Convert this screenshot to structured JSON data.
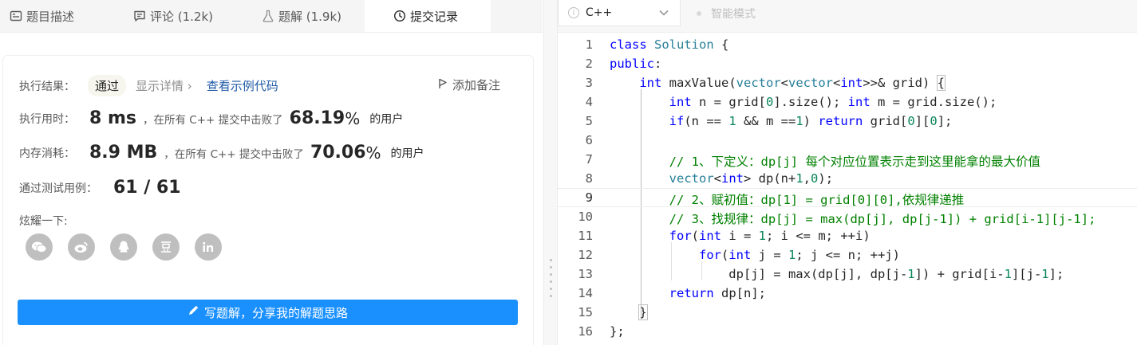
{
  "tabs": [
    {
      "label": "题目描述"
    },
    {
      "label": "评论 (1.2k)"
    },
    {
      "label": "题解 (1.9k)"
    },
    {
      "label": "提交记录"
    }
  ],
  "editor": {
    "language": "C++",
    "smart_mode": "智能模式"
  },
  "result": {
    "status_key": "执行结果：",
    "status": "通过",
    "show_details": "显示详情 ›",
    "view_example": "查看示例代码",
    "add_note": "添加备注",
    "runtime_key": "执行用时：",
    "runtime": "8 ms",
    "runtime_beat_text": "，在所有 C++ 提交中击败了",
    "runtime_pct": "68.19",
    "memory_key": "内存消耗：",
    "memory": "8.9 MB",
    "memory_beat_text": "，在所有 C++ 提交中击败了",
    "memory_pct": "70.06",
    "pct_sign": "%",
    "users_suffix": "的用户",
    "testcases_key": "通过测试用例：",
    "testcases": "61 / 61",
    "share_label": "炫耀一下:",
    "share_icons": [
      "wechat-icon",
      "weibo-icon",
      "qq-icon",
      "douban-icon",
      "linkedin-icon"
    ],
    "write_solution": "写题解，分享我的解题思路"
  },
  "code": {
    "line_numbers": [
      "1",
      "2",
      "3",
      "4",
      "5",
      "6",
      "7",
      "8",
      "9",
      "10",
      "11",
      "12",
      "13",
      "14",
      "15",
      "16"
    ],
    "lines": [
      "class Solution {",
      "public:",
      "    int maxValue(vector<vector<int>>& grid) {",
      "        int n = grid[0].size(); int m = grid.size();",
      "        if(n == 1 && m ==1) return grid[0][0];",
      "",
      "        // 1、下定义：dp[j] 每个对应位置表示走到这里能拿的最大价值",
      "        vector<int> dp(n+1,0);",
      "        // 2、赋初值：dp[1] = grid[0][0],依规律递推",
      "        // 3、找规律：dp[j] = max(dp[j], dp[j-1]) + grid[i-1][j-1];",
      "        for(int i = 1; i <= m; ++i)",
      "            for(int j = 1; j <= n; ++j)",
      "                dp[j] = max(dp[j], dp[j-1]) + grid[i-1][j-1];",
      "        return dp[n];",
      "    }",
      "};"
    ],
    "current_line": 9
  },
  "colors": {
    "primary_button": "#1a90ff",
    "link": "#1f5aa6",
    "keyword": "#0000ff",
    "comment": "#008000",
    "number": "#098658"
  }
}
